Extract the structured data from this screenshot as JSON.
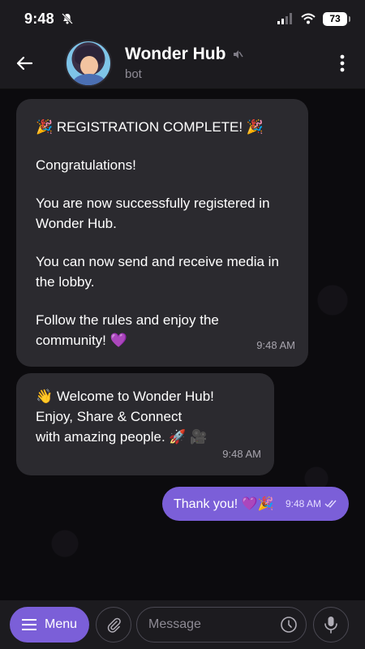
{
  "status_bar": {
    "time": "9:48",
    "battery": "73"
  },
  "header": {
    "title": "Wonder Hub",
    "subtitle": "bot"
  },
  "messages": [
    {
      "from": "bot",
      "heading": "🎉 REGISTRATION COMPLETE! 🎉",
      "lines": [
        "Congratulations!",
        "You are now successfully registered in Wonder Hub.",
        "You can now send and receive media in the lobby.",
        "Follow the rules and enjoy the community! 💜"
      ],
      "time": "9:48 AM"
    },
    {
      "from": "bot",
      "lines": [
        "👋 Welcome to Wonder Hub!",
        "Enjoy, Share & Connect",
        "with amazing people. 🚀 🎥"
      ],
      "time": "9:48 AM"
    },
    {
      "from": "me",
      "text": "Thank you! 💜🎉",
      "time": "9:48 AM"
    }
  ],
  "composer": {
    "menu_label": "Menu",
    "placeholder": "Message"
  },
  "colors": {
    "accent": "#7b5fd8",
    "bubble_in": "#2b2a2f",
    "bar": "#1c1b1f"
  },
  "icons": [
    "bell-off-icon",
    "signal-icon",
    "wifi-icon",
    "battery-icon",
    "back-arrow-icon",
    "mute-icon",
    "more-vertical-icon",
    "hamburger-icon",
    "paperclip-icon",
    "clock-icon",
    "microphone-icon",
    "double-check-icon"
  ]
}
